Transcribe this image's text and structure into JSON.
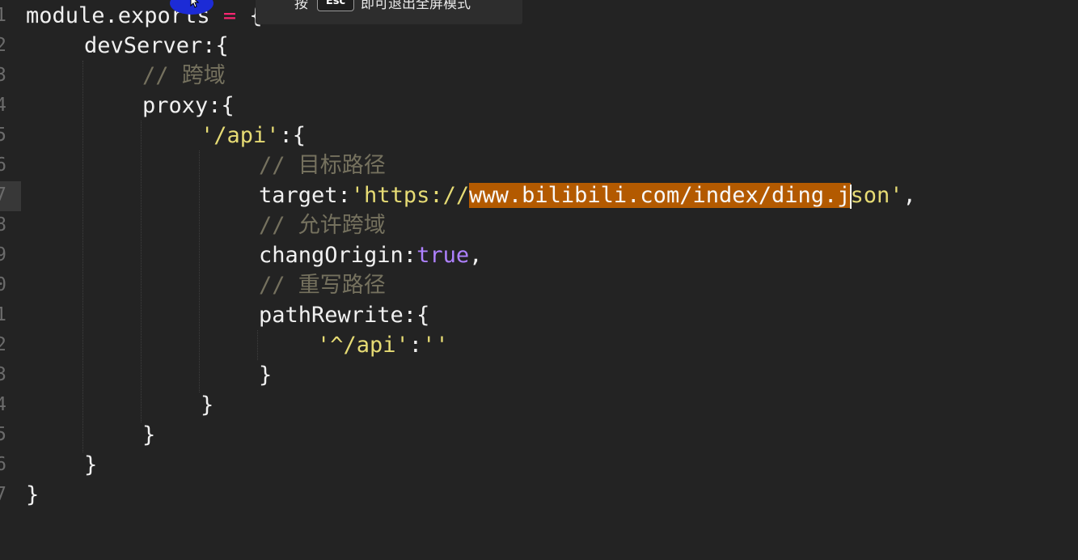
{
  "toast": {
    "prefix": "按",
    "key": "Esc",
    "suffix": "即可退出全屏模式"
  },
  "gutter": [
    "1",
    "2",
    "3",
    "4",
    "5",
    "6",
    "7",
    "8",
    "9",
    "0",
    "1",
    "2",
    "3",
    "4",
    "5",
    "6",
    "7"
  ],
  "code": {
    "l1": {
      "a": "module.exports",
      "b": " = ",
      "c": "{"
    },
    "l2": {
      "a": "devServer:{"
    },
    "l3": {
      "a": "// 跨域"
    },
    "l4": {
      "a": "proxy:{"
    },
    "l5": {
      "a": "'/api'",
      "b": ":{"
    },
    "l6": {
      "a": "// 目标路径"
    },
    "l7": {
      "a": "target:",
      "b": "'https://",
      "c": "www.bilibili.com/index/ding.j",
      "d": "son'",
      "e": ","
    },
    "l8": {
      "a": "// 允许跨域"
    },
    "l9": {
      "a": "changOrigin:",
      "b": "true",
      "c": ","
    },
    "l10": {
      "a": "// 重写路径"
    },
    "l11": {
      "a": "pathRewrite:{"
    },
    "l12": {
      "a": "'^/api'",
      "b": ":",
      "c": "''"
    },
    "l13": {
      "a": "}"
    },
    "l14": {
      "a": "}"
    },
    "l15": {
      "a": "}"
    },
    "l16": {
      "a": "}"
    },
    "l17": {
      "a": "}"
    }
  },
  "colors": {
    "background": "#232323",
    "string": "#e6db74",
    "comment": "#75715e",
    "boolean": "#ae81ff",
    "operator": "#f92672",
    "selection": "#b35a00"
  }
}
